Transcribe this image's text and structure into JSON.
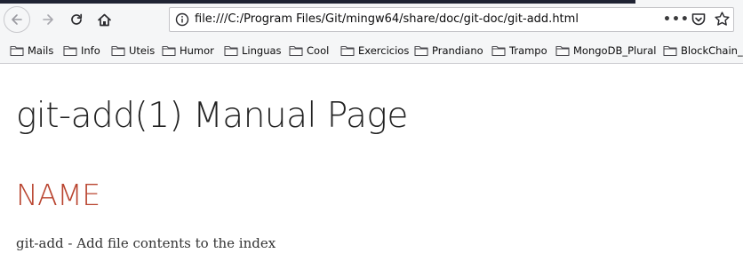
{
  "browser": {
    "url": "file:///C:/Program Files/Git/mingw64/share/doc/git-doc/git-add.html",
    "page_actions_glyph": "•••",
    "nav_icons": [
      "back-arrow-icon",
      "forward-arrow-icon",
      "reload-icon",
      "home-icon"
    ],
    "url_icons": [
      "info-icon",
      "pocket-icon",
      "star-icon"
    ]
  },
  "bookmarks": [
    {
      "label": "Mails"
    },
    {
      "label": "Info"
    },
    {
      "label": "Uteis"
    },
    {
      "label": "Humor"
    },
    {
      "label": "Linguas"
    },
    {
      "label": "Cool"
    },
    {
      "label": "Exercicios"
    },
    {
      "label": "Prandiano"
    },
    {
      "label": "Trampo"
    },
    {
      "label": "MongoDB_Plural"
    },
    {
      "label": "BlockChain_P"
    }
  ],
  "page": {
    "title": "git-add(1) Manual Page",
    "section_name": "NAME",
    "name_text": "git-add - Add file contents to the index"
  },
  "colors": {
    "heading_accent": "#b9442f",
    "title_text": "#222222",
    "toolbar_bg": "#f5f6f7"
  }
}
